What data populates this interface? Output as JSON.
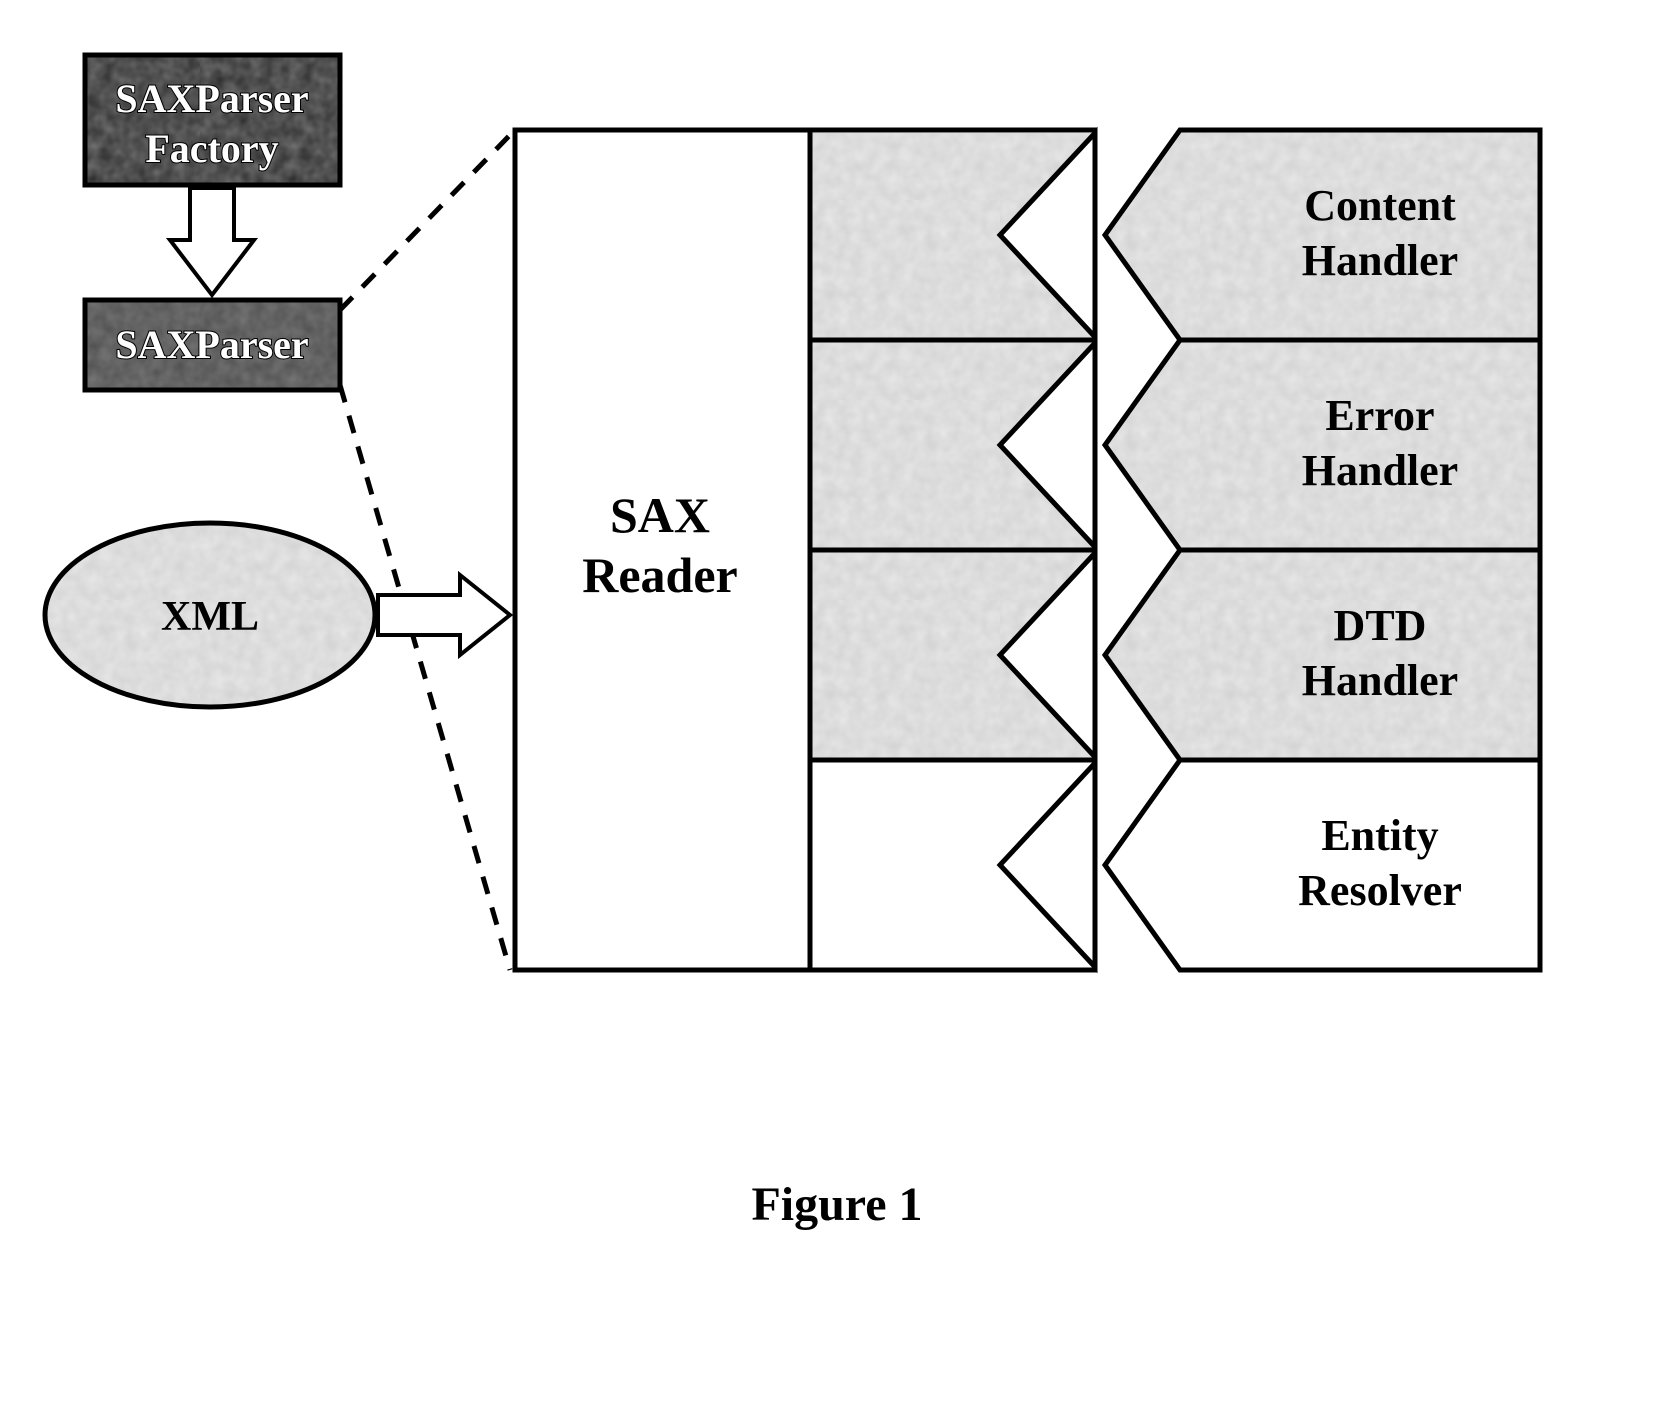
{
  "diagram": {
    "factory": "SAXParser\nFactory",
    "parser": "SAXParser",
    "xml": "XML",
    "reader": "SAX\nReader",
    "handlers": [
      {
        "label": "Content\nHandler",
        "shaded": true
      },
      {
        "label": "Error\nHandler",
        "shaded": true
      },
      {
        "label": "DTD\nHandler",
        "shaded": true
      },
      {
        "label": "Entity\nResolver",
        "shaded": false
      }
    ],
    "caption": "Figure 1"
  }
}
